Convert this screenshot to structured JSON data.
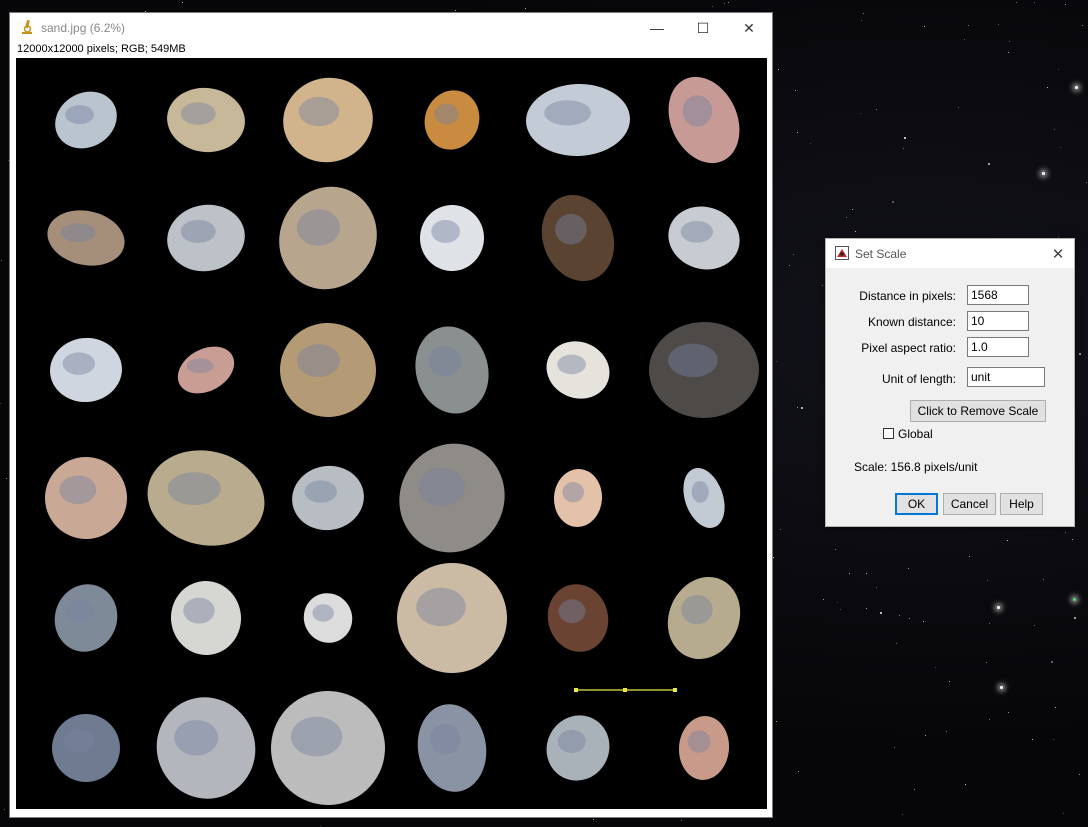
{
  "image_window": {
    "title": "sand.jpg (6.2%)",
    "info": "12000x12000 pixels; RGB; 549MB",
    "controls": {
      "minimize": "—",
      "maximize": "☐",
      "close": "✕"
    }
  },
  "set_scale_dialog": {
    "title": "Set Scale",
    "close": "✕",
    "fields": [
      {
        "label": "Distance in pixels:",
        "value": "1568"
      },
      {
        "label": "Known distance:",
        "value": "10"
      },
      {
        "label": "Pixel aspect ratio:",
        "value": "1.0"
      }
    ],
    "unit_label": "Unit of length:",
    "unit_value": "unit",
    "remove_scale_label": "Click to Remove Scale",
    "global_label": "Global",
    "global_checked": false,
    "scale_text": "Scale: 156.8 pixels/unit",
    "buttons": {
      "ok": "OK",
      "cancel": "Cancel",
      "help": "Help"
    }
  },
  "colors": {
    "selection_line": "#e8e84a",
    "default_button_border": "#0078d7"
  }
}
